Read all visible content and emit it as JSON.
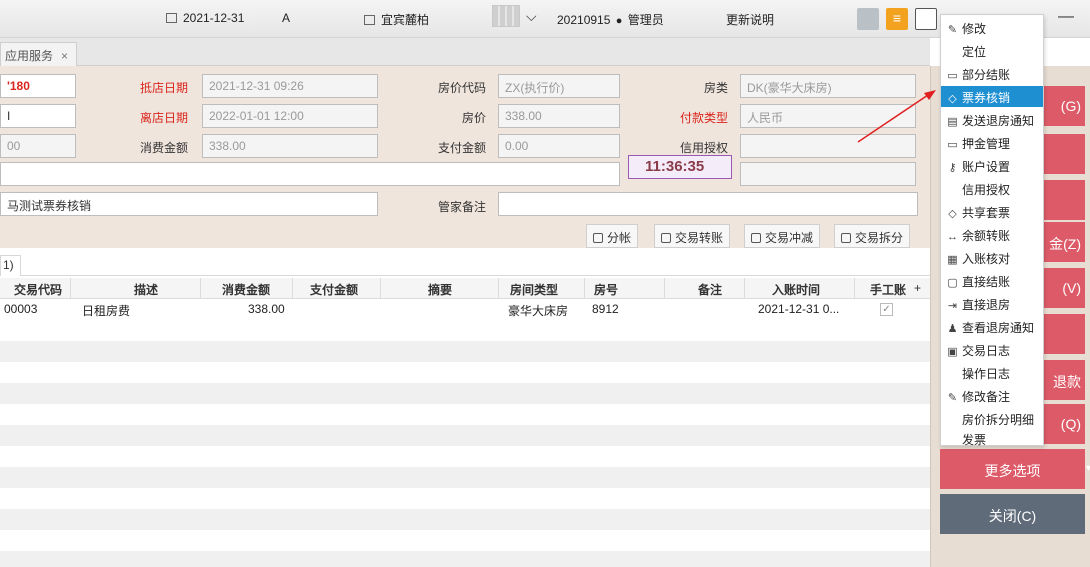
{
  "topbar": {
    "date": "2021-12-31",
    "shift": "A",
    "hotel": "宜宾麓柏",
    "user": "20210915",
    "role": "管理员",
    "release_notes": "更新说明"
  },
  "tab": {
    "label": "应用服务",
    "close": "×"
  },
  "form": {
    "room_no_partial": "'180",
    "left_field2": "I",
    "left_field3": "00",
    "remark_partial": "马测试票券核销",
    "arrival_label": "抵店日期",
    "arrival_value": "2021-12-31 09:26",
    "departure_label": "离店日期",
    "departure_value": "2022-01-01 12:00",
    "consumption_label": "消费金额",
    "consumption_value": "338.00",
    "rate_code_label": "房价代码",
    "rate_code_value": "ZX(执行价)",
    "rate_label": "房价",
    "rate_value": "338.00",
    "paid_label": "支付金额",
    "paid_value": "0.00",
    "room_type_label": "房类",
    "room_type_value": "DK(豪华大床房)",
    "payment_label": "付款类型",
    "payment_value": "人民币",
    "credit_label": "信用授权",
    "credit_value": "",
    "butler_label": "管家备注",
    "clock": "11:36:35"
  },
  "actions": {
    "split": "分帐",
    "transfer": "交易转账",
    "reverse": "交易冲减",
    "split_trade": "交易拆分"
  },
  "subtab": "1)",
  "table": {
    "headers": [
      "交易代码",
      "描述",
      "消费金额",
      "支付金额",
      "摘要",
      "房间类型",
      "房号",
      "备注",
      "入账时间",
      "手工账"
    ],
    "rows": [
      {
        "code": "00003",
        "desc": "日租房费",
        "amount": "338.00",
        "paid": "",
        "summary": "",
        "room_type": "豪华大床房",
        "room_no": "8912",
        "note": "",
        "time": "2021-12-31 0...",
        "manual": "✓"
      }
    ]
  },
  "right_panel": {
    "btn1": "(G)",
    "btn4": "金(Z)",
    "btn5": "(V)",
    "btn6": "退款",
    "btn7": "(Q)",
    "more": "更多选项",
    "close": "关闭(C)"
  },
  "menu": {
    "items": [
      {
        "icon": "✎",
        "label": "修改"
      },
      {
        "icon": "",
        "label": "定位"
      },
      {
        "icon": "▭",
        "label": "部分结账"
      },
      {
        "icon": "◇",
        "label": "票券核销",
        "active": true
      },
      {
        "icon": "▤",
        "label": "发送退房通知"
      },
      {
        "icon": "▭",
        "label": "押金管理"
      },
      {
        "icon": "⚷",
        "label": "账户设置"
      },
      {
        "icon": "",
        "label": "信用授权"
      },
      {
        "icon": "◇",
        "label": "共享套票"
      },
      {
        "icon": "↔",
        "label": "余额转账"
      },
      {
        "icon": "▦",
        "label": "入账核对"
      },
      {
        "icon": "▢",
        "label": "直接结账"
      },
      {
        "icon": "⇥",
        "label": "直接退房"
      },
      {
        "icon": "♟",
        "label": "查看退房通知"
      },
      {
        "icon": "▣",
        "label": "交易日志"
      },
      {
        "icon": "",
        "label": "操作日志"
      },
      {
        "icon": "✎",
        "label": "修改备注"
      },
      {
        "icon": "",
        "label": "房价拆分明细"
      },
      {
        "icon": "",
        "label": "发票"
      }
    ]
  },
  "colors": {
    "accent_red": "#dd5b68",
    "menu_highlight": "#1e8fd0",
    "close_button": "#5f6b79",
    "form_background": "#efe5dd",
    "label_red": "#d9251d"
  }
}
